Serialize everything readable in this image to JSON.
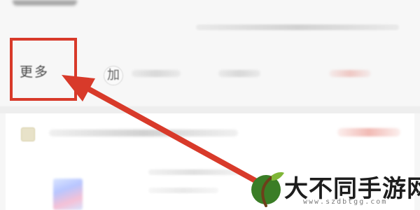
{
  "tabs": {
    "more_label": "更多",
    "partial_label": "加"
  },
  "watermark": {
    "title": "大不同手游网",
    "url": "www.szdbtgg.com"
  },
  "colors": {
    "highlight_red": "#d83a2a",
    "logo_green": "#3a7d26",
    "logo_leaf": "#7fb637",
    "logo_brown": "#6d3f1a"
  },
  "icons": {
    "arrow": "arrow-pointing-up-left",
    "logo": "sprout-logo-icon"
  }
}
